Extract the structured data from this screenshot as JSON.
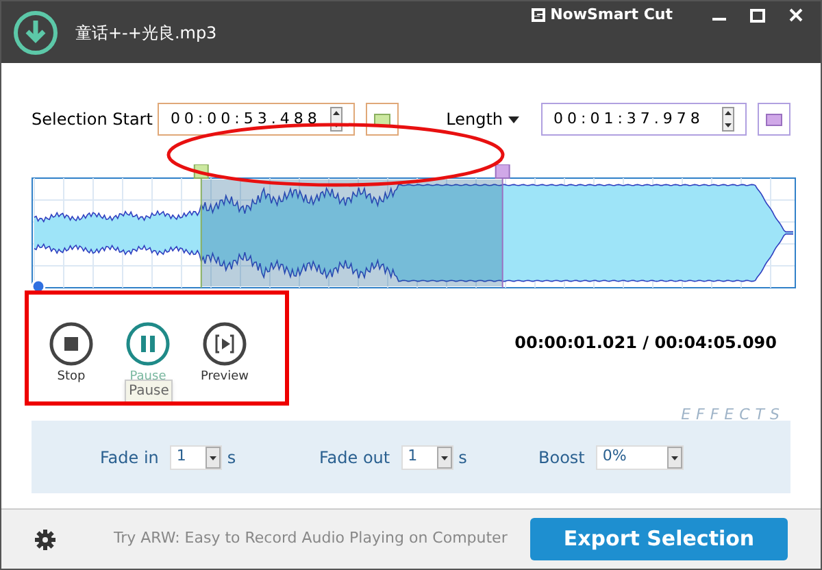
{
  "window": {
    "app_name": "NowSmart Cut",
    "file_name": "童话+-+光良.mp3"
  },
  "selection_start": {
    "label": "Selection Start",
    "value": "00:00:53.488"
  },
  "length": {
    "label": "Length",
    "value": "00:01:37.978"
  },
  "selection": {
    "start": {
      "level": 0.22
    },
    "end": {
      "level": 0.617
    }
  },
  "playhead": {
    "level": 0
  },
  "controls": [
    {
      "kind": "stop",
      "label": "Stop",
      "active": false
    },
    {
      "kind": "pause",
      "label": "Pause",
      "active": true
    },
    {
      "kind": "preview",
      "label": "Preview",
      "active": false
    }
  ],
  "tooltip": "Pause",
  "time_display": "00:00:01.021 / 00:04:05.090",
  "effects": {
    "title": "EFFECTS",
    "fields": [
      {
        "label": "Fade in",
        "value": "1",
        "unit": "s"
      },
      {
        "label": "Fade out",
        "value": "1",
        "unit": "s"
      },
      {
        "label": "Boost",
        "value": "0%"
      }
    ]
  },
  "footer": {
    "promo": "Try ARW: Easy to Record Audio Playing on Computer",
    "export_button": "Export Selection"
  }
}
